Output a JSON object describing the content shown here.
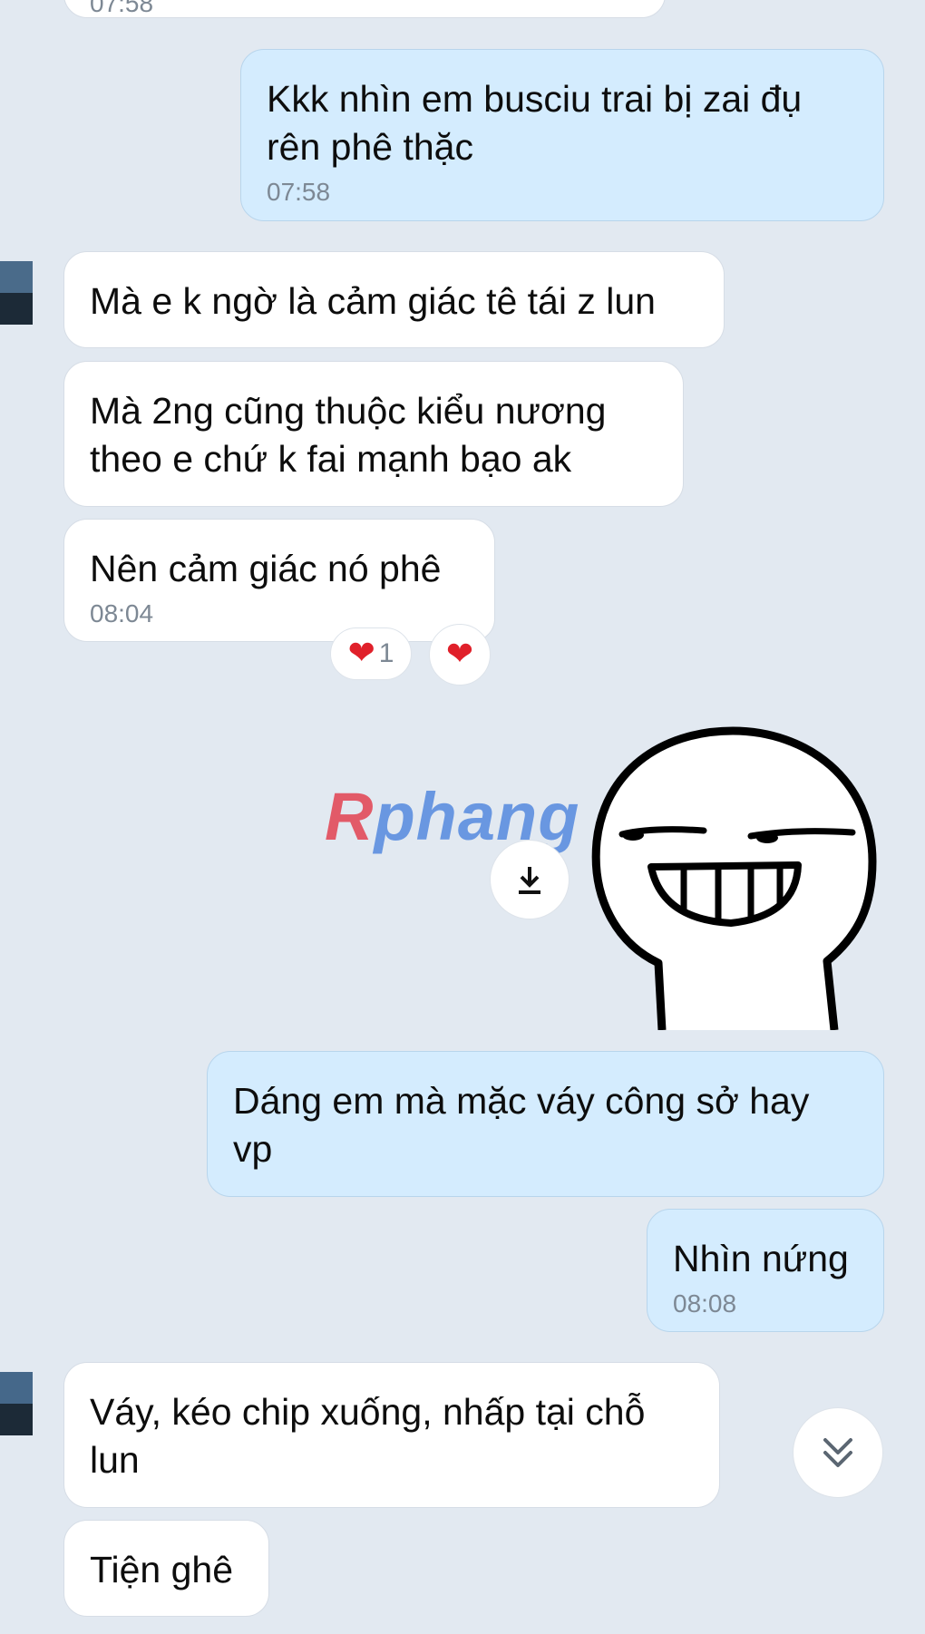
{
  "messages": {
    "top_partial_time": "07:58",
    "m1": {
      "text": "Kkk nhìn em busciu trai bị zai đụ rên phê thặc",
      "time": "07:58"
    },
    "m2": {
      "text": "Mà e k ngờ là cảm giác tê tái z lun"
    },
    "m3": {
      "text": "Mà 2ng cũng thuộc kiểu nương theo e chứ k fai mạnh bạo ak"
    },
    "m4": {
      "text": "Nên cảm giác nó phê",
      "time": "08:04"
    },
    "m5": {
      "text": "Dáng em mà mặc váy công sở hay vp"
    },
    "m6": {
      "text": "Nhìn nứng",
      "time": "08:08"
    },
    "m7": {
      "text": "Váy, kéo chip xuống, nhấp tại chỗ lun"
    },
    "m8": {
      "text": "Tiện ghê"
    }
  },
  "reactions": {
    "heart_count": "1",
    "heart_icon": "heart-icon"
  },
  "watermark": {
    "part1": "R",
    "part2": "phang"
  },
  "icons": {
    "download": "download-icon",
    "scroll_down": "double-chevron-down-icon"
  },
  "colors": {
    "background": "#e2e9f1",
    "incoming": "#ffffff",
    "outgoing": "#d4ecfe",
    "heart": "#e0202a"
  }
}
